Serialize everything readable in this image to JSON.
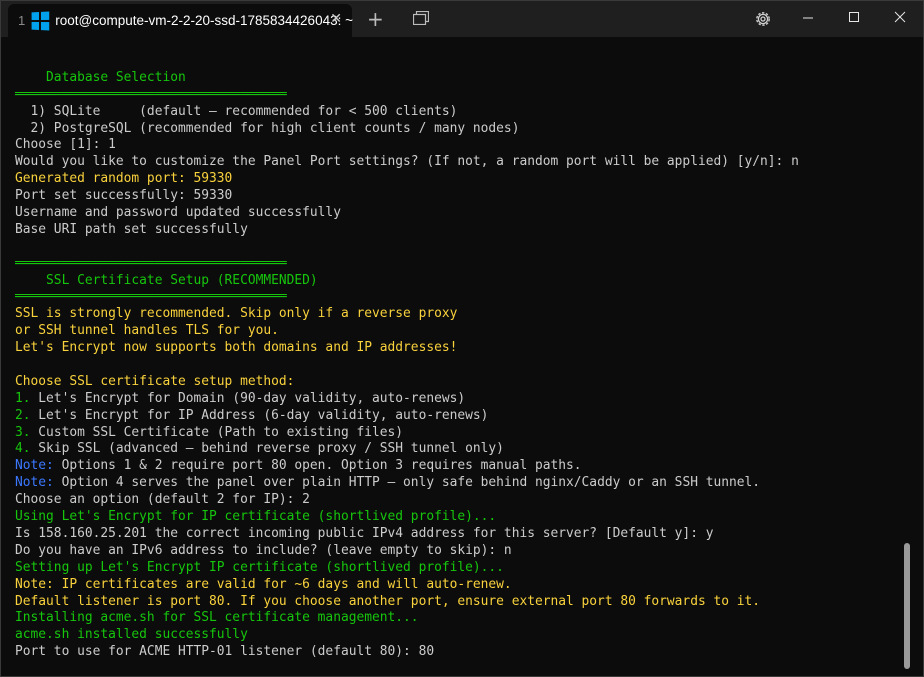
{
  "tab": {
    "index": "1",
    "title": "root@compute-vm-2-2-20-ssd-1785834426043: ~",
    "close": "✕"
  },
  "toolbar": {
    "new_tab": "+"
  },
  "colors": {
    "green": "#16c60c",
    "yellow": "#f9d23c",
    "blue": "#3b78ff",
    "text": "#cccccc",
    "bg": "#0c0c0c"
  },
  "terminal": {
    "lines": [
      [
        {
          "t": "",
          "c": "white"
        }
      ],
      [
        {
          "t": "    Database Selection",
          "c": "green"
        }
      ],
      [
        {
          "t": "═══════════════════════════════════",
          "c": "green"
        }
      ],
      [
        {
          "t": "  1) SQLite     (default — recommended for < 500 clients)",
          "c": "white"
        }
      ],
      [
        {
          "t": "  2) PostgreSQL (recommended for high client counts / many nodes)",
          "c": "white"
        }
      ],
      [
        {
          "t": "Choose [1]: 1",
          "c": "white"
        }
      ],
      [
        {
          "t": "Would you like to customize the Panel Port settings? (If not, a random port will be applied) [y/n]: n",
          "c": "white"
        }
      ],
      [
        {
          "t": "Generated random port: 59330",
          "c": "yellow"
        }
      ],
      [
        {
          "t": "Port set successfully: 59330",
          "c": "white"
        }
      ],
      [
        {
          "t": "Username and password updated successfully",
          "c": "white"
        }
      ],
      [
        {
          "t": "Base URI path set successfully",
          "c": "white"
        }
      ],
      [
        {
          "t": "",
          "c": "white"
        }
      ],
      [
        {
          "t": "═══════════════════════════════════",
          "c": "green"
        }
      ],
      [
        {
          "t": "    SSL Certificate Setup (RECOMMENDED)",
          "c": "green"
        }
      ],
      [
        {
          "t": "═══════════════════════════════════",
          "c": "green"
        }
      ],
      [
        {
          "t": "SSL is strongly recommended. Skip only if a reverse proxy",
          "c": "yellow"
        }
      ],
      [
        {
          "t": "or SSH tunnel handles TLS for you.",
          "c": "yellow"
        }
      ],
      [
        {
          "t": "Let's Encrypt now supports both domains and IP addresses!",
          "c": "yellow"
        }
      ],
      [
        {
          "t": "",
          "c": "white"
        }
      ],
      [
        {
          "t": "Choose SSL certificate setup method:",
          "c": "yellow"
        }
      ],
      [
        {
          "t": "1.",
          "c": "green"
        },
        {
          "t": " Let's Encrypt for Domain (90-day validity, auto-renews)",
          "c": "white"
        }
      ],
      [
        {
          "t": "2.",
          "c": "green"
        },
        {
          "t": " Let's Encrypt for IP Address (6-day validity, auto-renews)",
          "c": "white"
        }
      ],
      [
        {
          "t": "3.",
          "c": "green"
        },
        {
          "t": " Custom SSL Certificate (Path to existing files)",
          "c": "white"
        }
      ],
      [
        {
          "t": "4.",
          "c": "green"
        },
        {
          "t": " Skip SSL (advanced — behind reverse proxy / SSH tunnel only)",
          "c": "white"
        }
      ],
      [
        {
          "t": "Note:",
          "c": "blue"
        },
        {
          "t": " Options 1 & 2 require port 80 open. Option 3 requires manual paths.",
          "c": "white"
        }
      ],
      [
        {
          "t": "Note:",
          "c": "blue"
        },
        {
          "t": " Option 4 serves the panel over plain HTTP — only safe behind nginx/Caddy or an SSH tunnel.",
          "c": "white"
        }
      ],
      [
        {
          "t": "Choose an option (default 2 for IP): 2",
          "c": "white"
        }
      ],
      [
        {
          "t": "Using Let's Encrypt for IP certificate (shortlived profile)...",
          "c": "green"
        }
      ],
      [
        {
          "t": "Is 158.160.25.201 the correct incoming public IPv4 address for this server? [Default y]: y",
          "c": "white"
        }
      ],
      [
        {
          "t": "Do you have an IPv6 address to include? (leave empty to skip): n",
          "c": "white"
        }
      ],
      [
        {
          "t": "Setting up Let's Encrypt IP certificate (shortlived profile)...",
          "c": "green"
        }
      ],
      [
        {
          "t": "Note: IP certificates are valid for ~6 days and will auto-renew.",
          "c": "yellow"
        }
      ],
      [
        {
          "t": "Default listener is port 80. If you choose another port, ensure external port 80 forwards to it.",
          "c": "yellow"
        }
      ],
      [
        {
          "t": "Installing acme.sh for SSL certificate management...",
          "c": "green"
        }
      ],
      [
        {
          "t": "acme.sh installed successfully",
          "c": "green"
        }
      ],
      [
        {
          "t": "Port to use for ACME HTTP-01 listener (default 80): 80",
          "c": "white"
        }
      ]
    ]
  }
}
